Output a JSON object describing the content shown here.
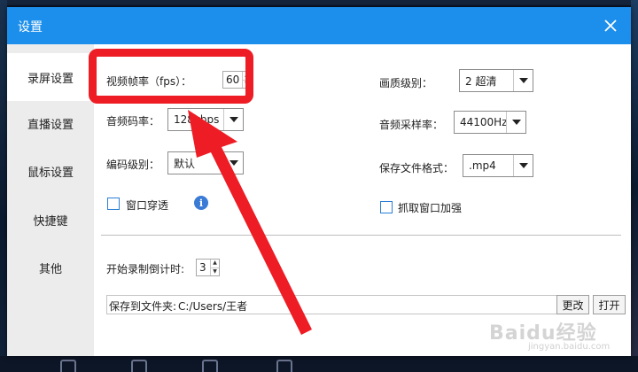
{
  "dialog": {
    "title": "设置",
    "close_symbol": "✕"
  },
  "sidebar": {
    "items": [
      {
        "label": "录屏设置",
        "active": true
      },
      {
        "label": "直播设置"
      },
      {
        "label": "鼠标设置"
      },
      {
        "label": "快捷键"
      },
      {
        "label": "其他"
      }
    ]
  },
  "settings": {
    "fps_label": "视频帧率（fps）：",
    "fps_value": "60",
    "audio_bitrate_label": "音频码率：",
    "audio_bitrate_value": "128kbps",
    "encoding_level_label": "编码级别：",
    "encoding_level_value": "默认",
    "window_pass_label": "窗口穿透",
    "window_pass_checked": false,
    "quality_label": "画质级别：",
    "quality_value": "2 超清",
    "sample_rate_label": "音频采样率：",
    "sample_rate_value": "44100Hz",
    "file_format_label": "保存文件格式：",
    "file_format_value": ".mp4",
    "capture_enhance_label": "抓取窗口加强",
    "capture_enhance_checked": false,
    "countdown_label": "开始录制倒计时:",
    "countdown_value": "3",
    "save_path_label": "保存到文件夹:",
    "save_path_value": "C:/Users/王者",
    "change_button": "更改",
    "open_button": "打开"
  },
  "icons": {
    "info": "i",
    "spin_up": "▲",
    "spin_down": "▼"
  },
  "colors": {
    "titlebar": "#1c8fec",
    "annotation": "#ee1c24",
    "sidebar_bg": "#ececec"
  },
  "watermark": {
    "text": "Baidu经验",
    "sub": "jingyan.baidu.com"
  }
}
